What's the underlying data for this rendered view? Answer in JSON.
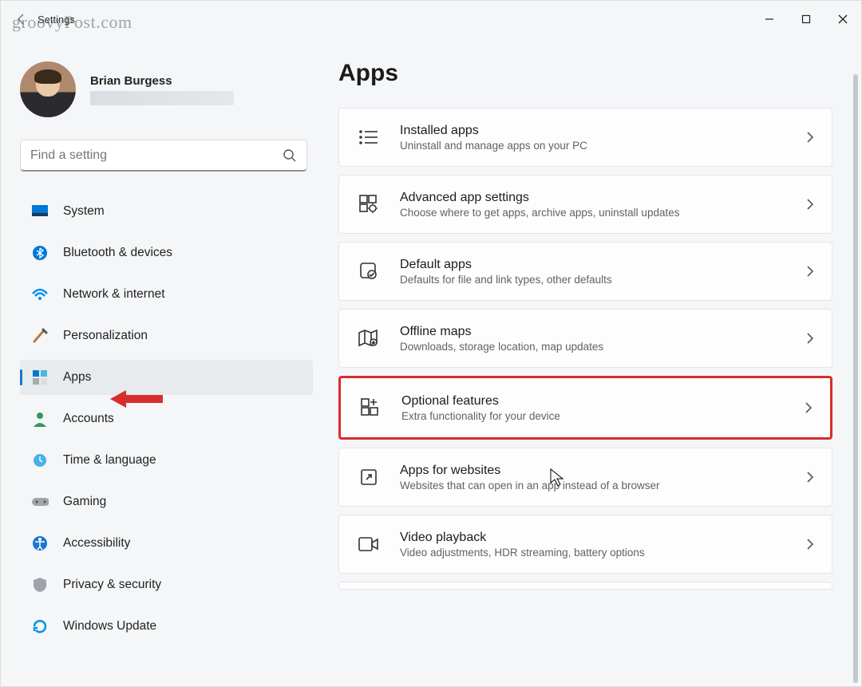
{
  "watermark": "groovyPost.com",
  "app_title": "Settings",
  "profile": {
    "name": "Brian Burgess"
  },
  "search": {
    "placeholder": "Find a setting"
  },
  "nav": {
    "system": "System",
    "bluetooth": "Bluetooth & devices",
    "network": "Network & internet",
    "personalization": "Personalization",
    "apps": "Apps",
    "accounts": "Accounts",
    "time": "Time & language",
    "gaming": "Gaming",
    "accessibility": "Accessibility",
    "privacy": "Privacy & security",
    "update": "Windows Update"
  },
  "page": {
    "title": "Apps"
  },
  "cards": {
    "installed": {
      "title": "Installed apps",
      "sub": "Uninstall and manage apps on your PC"
    },
    "advanced": {
      "title": "Advanced app settings",
      "sub": "Choose where to get apps, archive apps, uninstall updates"
    },
    "default": {
      "title": "Default apps",
      "sub": "Defaults for file and link types, other defaults"
    },
    "offline": {
      "title": "Offline maps",
      "sub": "Downloads, storage location, map updates"
    },
    "optional": {
      "title": "Optional features",
      "sub": "Extra functionality for your device"
    },
    "websites": {
      "title": "Apps for websites",
      "sub": "Websites that can open in an app instead of a browser"
    },
    "video": {
      "title": "Video playback",
      "sub": "Video adjustments, HDR streaming, battery options"
    }
  }
}
